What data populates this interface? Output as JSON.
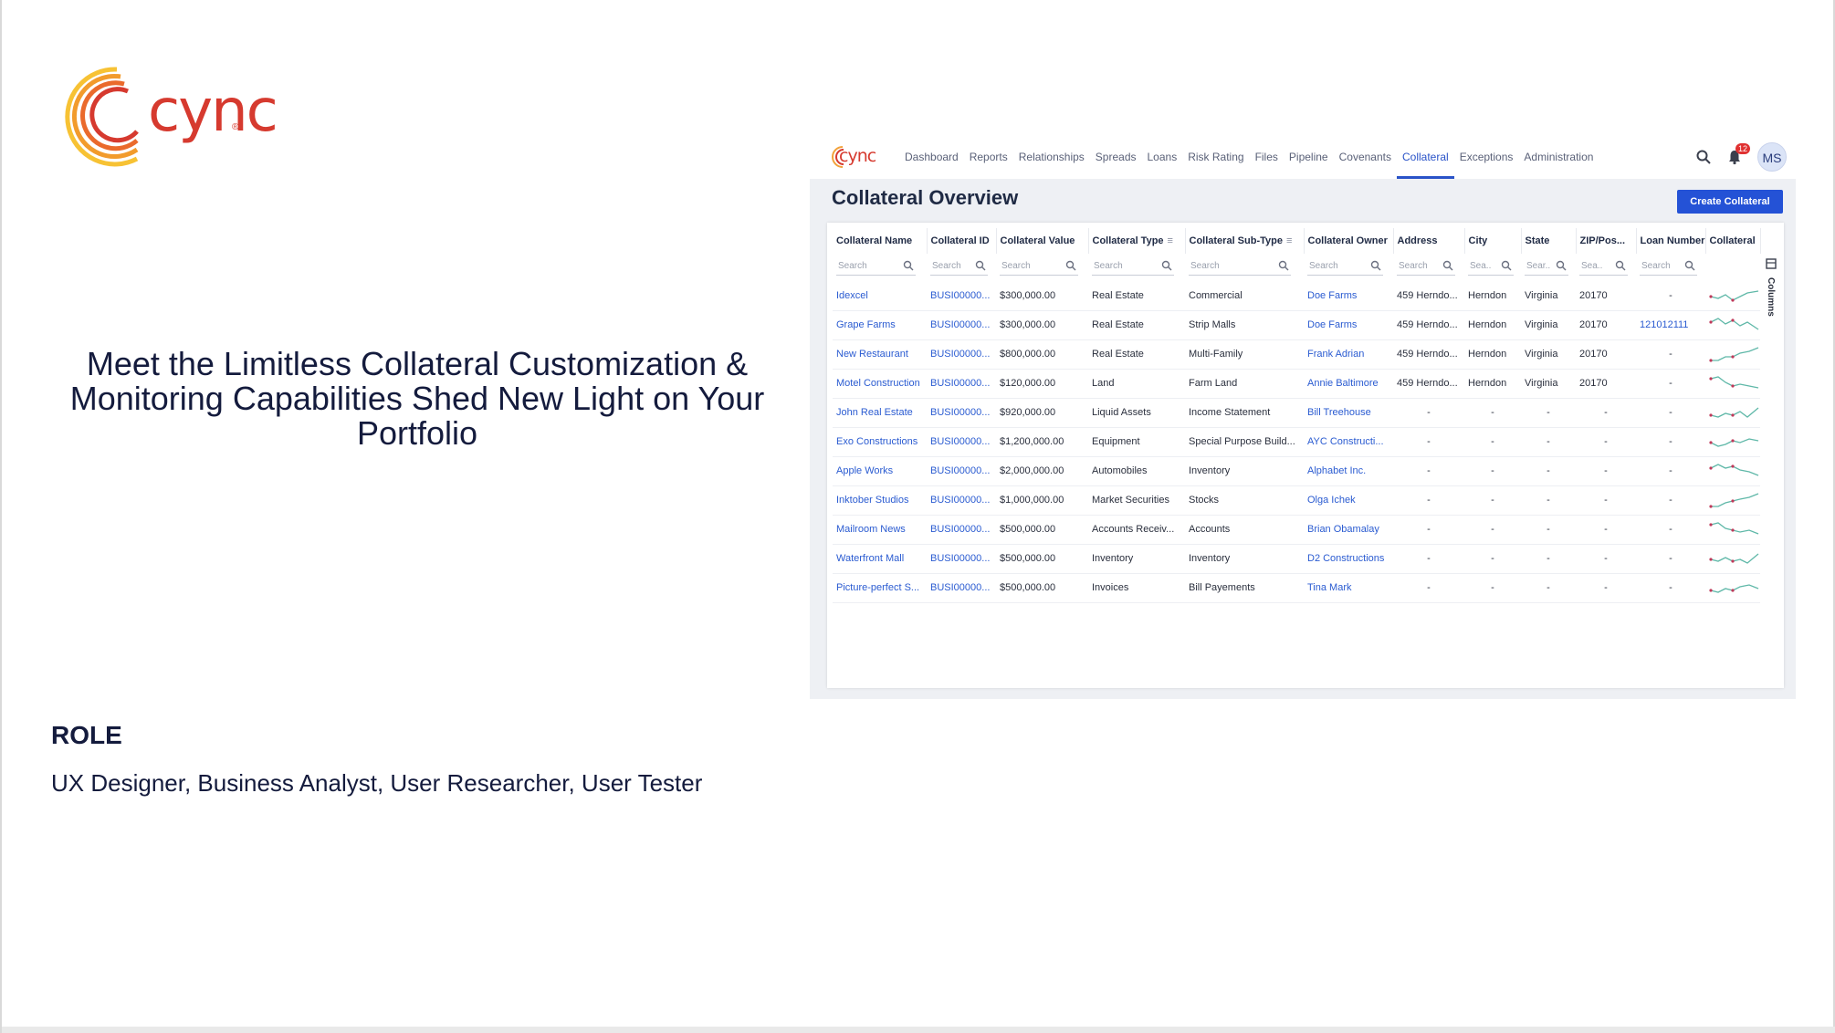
{
  "slide": {
    "logo_text": "cync",
    "logo_reg": "®",
    "headline_1": "Meet the Limitless Collateral Customization &",
    "headline_2": "Monitoring Capabilities Shed New Light on Your",
    "headline_3": "Portfolio",
    "role_title": "ROLE",
    "role_text": "UX Designer, Business Analyst, User Researcher, User Tester"
  },
  "app": {
    "logo_text": "cync",
    "nav": [
      {
        "label": "Dashboard"
      },
      {
        "label": "Reports"
      },
      {
        "label": "Relationships"
      },
      {
        "label": "Spreads"
      },
      {
        "label": "Loans"
      },
      {
        "label": "Risk Rating"
      },
      {
        "label": "Files"
      },
      {
        "label": "Pipeline"
      },
      {
        "label": "Covenants"
      },
      {
        "label": "Collateral"
      },
      {
        "label": "Exceptions"
      },
      {
        "label": "Administration"
      }
    ],
    "active_nav": "Collateral",
    "notification_count": "12",
    "avatar": "MS",
    "page_title": "Collateral Overview",
    "create_button": "Create Collateral",
    "columns_label": "Columns",
    "table": {
      "columns": [
        "Collateral Name",
        "Collateral ID",
        "Collateral Value",
        "Collateral Type",
        "Collateral Sub-Type",
        "Collateral Owner",
        "Address",
        "City",
        "State",
        "ZIP/Pos...",
        "Loan Number",
        "Collateral"
      ],
      "search_placeholders": [
        "Search",
        "Search",
        "Search",
        "Search",
        "Search",
        "Search",
        "Search",
        "Sea..",
        "Sear..",
        "Sea..",
        "Search"
      ],
      "rows": [
        [
          "Idexcel",
          "BUSI00000...",
          "$300,000.00",
          "Real Estate",
          "Commercial",
          "Doe Farms",
          "459 Herndo...",
          "Herndon",
          "Virginia",
          "20170",
          "-"
        ],
        [
          "Grape Farms",
          "BUSI00000...",
          "$300,000.00",
          "Real Estate",
          "Strip Malls",
          "Doe Farms",
          "459 Herndo...",
          "Herndon",
          "Virginia",
          "20170",
          "121012111"
        ],
        [
          "New Restaurant",
          "BUSI00000...",
          "$800,000.00",
          "Real Estate",
          "Multi-Family",
          "Frank Adrian",
          "459 Herndo...",
          "Herndon",
          "Virginia",
          "20170",
          "-"
        ],
        [
          "Motel Construction",
          "BUSI00000...",
          "$120,000.00",
          "Land",
          "Farm Land",
          "Annie Baltimore",
          "459 Herndo...",
          "Herndon",
          "Virginia",
          "20170",
          "-"
        ],
        [
          "John Real Estate",
          "BUSI00000...",
          "$920,000.00",
          "Liquid Assets",
          "Income Statement",
          "Bill Treehouse",
          "-",
          "-",
          "-",
          "-",
          "-"
        ],
        [
          "Exo Constructions",
          "BUSI00000...",
          "$1,200,000.00",
          "Equipment",
          "Special Purpose Build...",
          "AYC Constructi...",
          "-",
          "-",
          "-",
          "-",
          "-"
        ],
        [
          "Apple Works",
          "BUSI00000...",
          "$2,000,000.00",
          "Automobiles",
          "Inventory",
          "Alphabet Inc.",
          "-",
          "-",
          "-",
          "-",
          "-"
        ],
        [
          "Inktober Studios",
          "BUSI00000...",
          "$1,000,000.00",
          "Market Securities",
          "Stocks",
          "Olga Ichek",
          "-",
          "-",
          "-",
          "-",
          "-"
        ],
        [
          "Mailroom News",
          "BUSI00000...",
          "$500,000.00",
          "Accounts Receiv...",
          "Accounts",
          "Brian Obamalay",
          "-",
          "-",
          "-",
          "-",
          "-"
        ],
        [
          "Waterfront Mall",
          "BUSI00000...",
          "$500,000.00",
          "Inventory",
          "Inventory",
          "D2 Constructions",
          "-",
          "-",
          "-",
          "-",
          "-"
        ],
        [
          "Picture-perfect S...",
          "BUSI00000...",
          "$500,000.00",
          "Invoices",
          "Bill Payements",
          "Tina Mark",
          "-",
          "-",
          "-",
          "-",
          "-"
        ]
      ]
    },
    "colors": {
      "accent": "#2452d6",
      "link": "#2a5bd1",
      "brand": "#d63a2f",
      "spark": "#5fb8a8",
      "spark_dot": "#c0395a"
    }
  }
}
